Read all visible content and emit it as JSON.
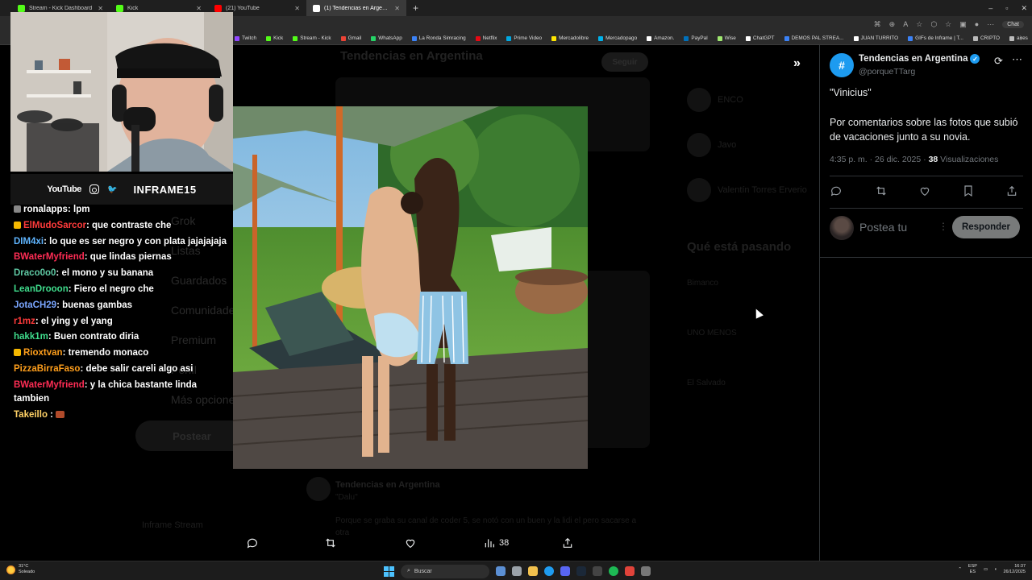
{
  "browser": {
    "tabs": [
      {
        "label": "Stream - Kick Dashboard",
        "color": "#53fc18"
      },
      {
        "label": "Kick",
        "color": "#53fc18"
      },
      {
        "label": "(21) YouTube",
        "color": "#ff0000"
      },
      {
        "label": "(1) Tendencias en Argentina (@po",
        "color": "#ffffff",
        "active": true
      }
    ],
    "bookmarks": [
      {
        "label": "Twitch",
        "color": "#9146ff"
      },
      {
        "label": "Kick",
        "color": "#53fc18"
      },
      {
        "label": "Stream - Kick",
        "color": "#53fc18"
      },
      {
        "label": "Gmail",
        "color": "#ea4335"
      },
      {
        "label": "WhatsApp",
        "color": "#25d366"
      },
      {
        "label": "La Ronda Simracing",
        "color": "#3b82f6"
      },
      {
        "label": "Netflix",
        "color": "#e50914"
      },
      {
        "label": "Prime Video",
        "color": "#00a8e1"
      },
      {
        "label": "Mercadolibre",
        "color": "#ffe600"
      },
      {
        "label": "Mercadopago",
        "color": "#00b1ea"
      },
      {
        "label": "Amazon.",
        "color": "#ffffff"
      },
      {
        "label": "PayPal",
        "color": "#0070ba"
      },
      {
        "label": "Wise",
        "color": "#9fe870"
      },
      {
        "label": "ChatGPT",
        "color": "#ffffff"
      },
      {
        "label": "DEMOS PAL STREA...",
        "color": "#3b82f6"
      },
      {
        "label": "JUAN TURRITO",
        "color": "#ffffff"
      },
      {
        "label": "GIFs de Inframe | T...",
        "color": "#3b82f6"
      },
      {
        "label": "CRIPTO",
        "color": "#bbbbbb"
      },
      {
        "label": "aires",
        "color": "#bbbbbb"
      }
    ],
    "chat_button": "Chat"
  },
  "background": {
    "header_title": "Tendencias en Argentina",
    "follow_label": "Seguir",
    "nav": [
      "Grok",
      "Listas",
      "Guardados",
      "Comunidades",
      "Premium",
      "Perfil",
      "Más opciones"
    ],
    "post_button": "Postear",
    "user_name": "Inframe Stream",
    "sidebar_users": [
      "ENCO",
      "Javo",
      "Valentín Torres Erverio"
    ],
    "trends_title": "Qué está pasando",
    "trends": [
      "Bimanco",
      "UNO MENOS",
      "El Salvado"
    ],
    "tweet_name": "Tendencias en Argentina",
    "tweet_quote": "\"Dalu\"",
    "tweet_text": "Porque se graba su canal de coder 5, se notó con un buen y la lidi el pero sacarse a otra"
  },
  "photo_actions": {
    "views": "38"
  },
  "panel": {
    "avatar_glyph": "#",
    "name": "Tendencias en Argentina",
    "handle": "@porqueTTarg",
    "quote": "\"Vinicius\"",
    "body": "Por comentarios sobre las fotos que subió de vacaciones junto a su novia.",
    "time": "4:35 p. m. · 26 dic. 2025 · ",
    "views_count": "38",
    "views_label": " Visualizaciones",
    "reply_placeholder": "Postea tu",
    "reply_button": "Responder"
  },
  "stream": {
    "youtube_label": "YouTube",
    "handle": "INFRAME15"
  },
  "chat": [
    {
      "user": "ronalapps",
      "color": "#ffffff",
      "text": ": lpm",
      "badge": "#888888"
    },
    {
      "user": "ElMudoSarcor",
      "color": "#ff3b3b",
      "text": ": que contraste che",
      "badge": "#f5b800"
    },
    {
      "user": "DIM4xi",
      "color": "#5fb5ff",
      "text": ": lo que es ser negro y con plata jajajajaja"
    },
    {
      "user": "BWaterMyfriend",
      "color": "#ff2d55",
      "text": ": que lindas piernas"
    },
    {
      "user": "Draco0o0",
      "color": "#5fc9a4",
      "text": ": el mono y su banana"
    },
    {
      "user": "LeanDrooon",
      "color": "#3fdc8c",
      "text": ": Fiero el negro che"
    },
    {
      "user": "JotaCH29",
      "color": "#7aa6ff",
      "text": ": buenas gambas"
    },
    {
      "user": "r1mz",
      "color": "#ff3b3b",
      "text": ": el ying y el yang"
    },
    {
      "user": "hakk1m",
      "color": "#3fdc8c",
      "text": ": Buen contrato diria"
    },
    {
      "user": "Rioxtvan",
      "color": "#ff9f1c",
      "text": ": tremendo monaco",
      "badge": "#f5b800"
    },
    {
      "user": "PizzaBirraFaso",
      "color": "#ff9f1c",
      "text": ": debe salir careli algo asi"
    },
    {
      "user": "BWaterMyfriend",
      "color": "#ff2d55",
      "text": ": y la chica bastante linda tambien"
    },
    {
      "user": "Takeillo",
      "color": "#ffd166",
      "text": " : ",
      "emote": "#b04a2a"
    }
  ],
  "taskbar": {
    "temp": "31°C",
    "weather": "Soleado",
    "search": "Buscar",
    "lang_top": "ESP",
    "lang_bottom": "ES",
    "time": "16:37",
    "date": "26/12/2025"
  }
}
